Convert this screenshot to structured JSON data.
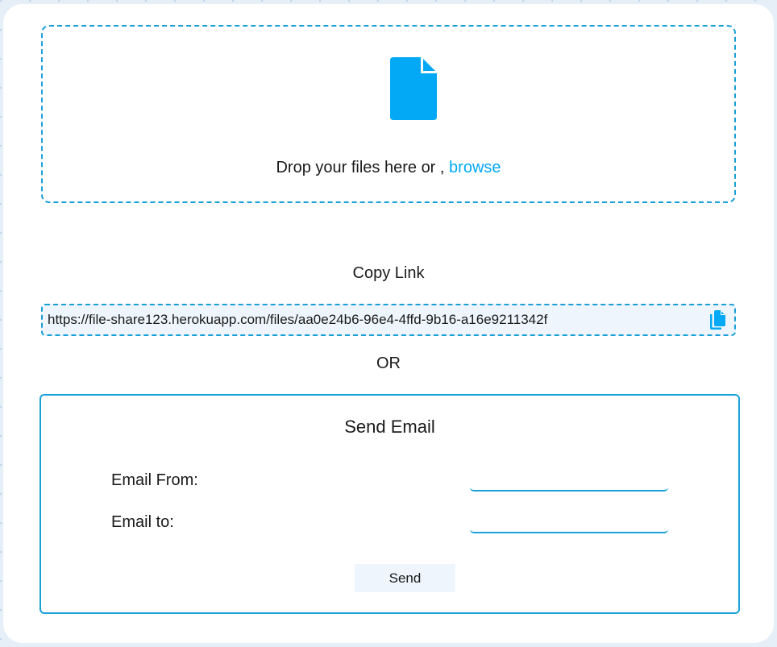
{
  "upload": {
    "drop_text": "Drop your files here or ,",
    "browse_label": "browse",
    "icon": "file-icon"
  },
  "share": {
    "title": "Copy Link",
    "link_value": "https://file-share123.herokuapp.com/files/aa0e24b6-96e4-4ffd-9b16-a16e9211342f",
    "copy_icon": "copy-icon"
  },
  "separator": "OR",
  "email": {
    "title": "Send Email",
    "from_label": "Email From:",
    "from_value": "",
    "to_label": "Email to:",
    "to_value": "",
    "send_label": "Send"
  },
  "colors": {
    "accent": "#03a9f4",
    "border": "#1aa0d8",
    "light_bg": "#eef5fd",
    "page_bg": "#e6eef8"
  }
}
